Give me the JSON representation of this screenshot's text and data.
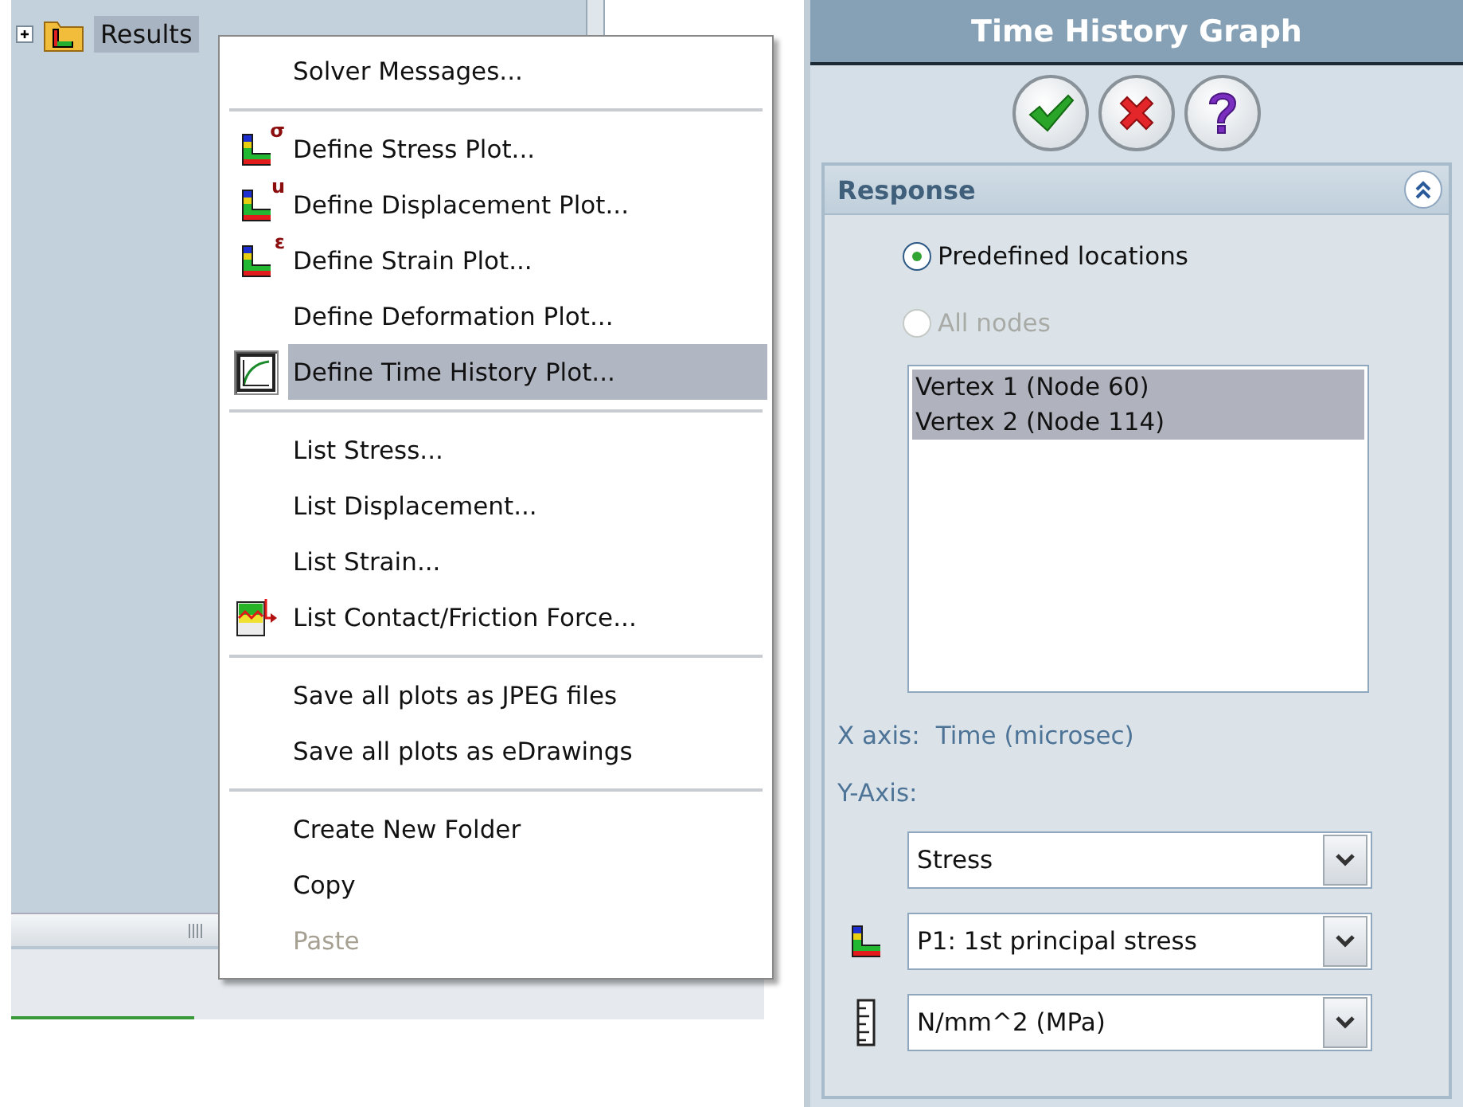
{
  "tree": {
    "items": [
      {
        "label": "Results",
        "selected": true,
        "expanded": false
      }
    ]
  },
  "context_menu": {
    "items": [
      {
        "kind": "plain",
        "label": "Solver Messages...",
        "selected": false,
        "disabled": false
      },
      {
        "kind": "separator"
      },
      {
        "kind": "plot",
        "label": "Define Stress Plot...",
        "badge": "σ",
        "selected": false,
        "disabled": false
      },
      {
        "kind": "plot",
        "label": "Define Displacement Plot...",
        "badge": "u",
        "selected": false,
        "disabled": false
      },
      {
        "kind": "plot",
        "label": "Define Strain Plot...",
        "badge": "ε",
        "selected": false,
        "disabled": false
      },
      {
        "kind": "plain",
        "label": "Define Deformation Plot...",
        "selected": false,
        "disabled": false
      },
      {
        "kind": "graph",
        "label": "Define Time History Plot...",
        "selected": true,
        "disabled": false
      },
      {
        "kind": "separator"
      },
      {
        "kind": "plain",
        "label": "List Stress...",
        "selected": false,
        "disabled": false
      },
      {
        "kind": "plain",
        "label": "List Displacement...",
        "selected": false,
        "disabled": false
      },
      {
        "kind": "plain",
        "label": "List Strain...",
        "selected": false,
        "disabled": false
      },
      {
        "kind": "force",
        "label": "List Contact/Friction Force...",
        "selected": false,
        "disabled": false
      },
      {
        "kind": "separator"
      },
      {
        "kind": "plain",
        "label": "Save all plots as JPEG files",
        "selected": false,
        "disabled": false
      },
      {
        "kind": "plain",
        "label": "Save all plots as eDrawings",
        "selected": false,
        "disabled": false
      },
      {
        "kind": "separator"
      },
      {
        "kind": "plain",
        "label": "Create New Folder",
        "selected": false,
        "disabled": false
      },
      {
        "kind": "plain",
        "label": "Copy",
        "selected": false,
        "disabled": false
      },
      {
        "kind": "plain",
        "label": "Paste",
        "selected": false,
        "disabled": true
      }
    ]
  },
  "panel": {
    "title": "Time History Graph",
    "response": {
      "title": "Response",
      "expanded": true,
      "options": [
        {
          "label": "Predefined locations",
          "selected": true,
          "disabled": false
        },
        {
          "label": "All nodes",
          "selected": false,
          "disabled": true
        }
      ],
      "locations": [
        {
          "label": "Vertex 1 (Node 60)",
          "selected": true
        },
        {
          "label": "Vertex 2 (Node 114)",
          "selected": true
        }
      ],
      "x_axis": {
        "label": "X axis:",
        "value": "Time (microsec)"
      },
      "y_axis_label": "Y-Axis:",
      "selects": [
        {
          "kind": "plain",
          "value": "Stress"
        },
        {
          "kind": "plot",
          "value": "P1: 1st principal stress"
        },
        {
          "kind": "ruler",
          "value": "N/mm^2 (MPa)"
        }
      ]
    }
  }
}
